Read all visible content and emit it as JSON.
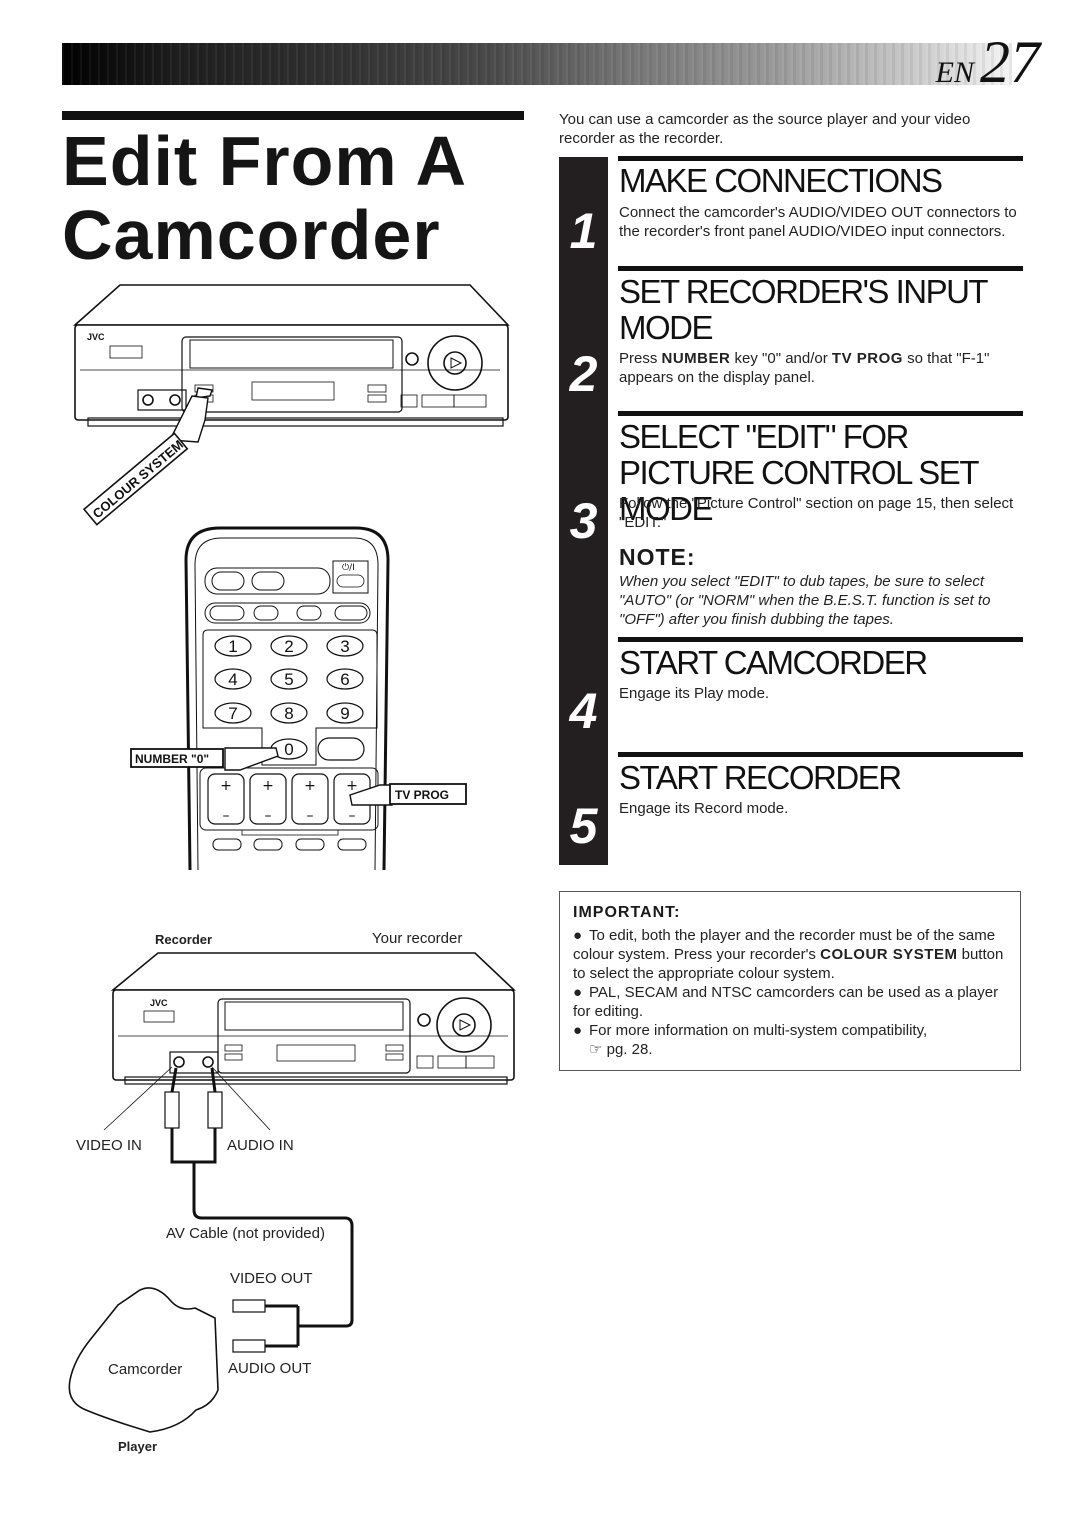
{
  "header": {
    "lang_code": "EN",
    "page_number": "27"
  },
  "title": {
    "line1": "Edit From A",
    "line2": "Camcorder"
  },
  "intro": "You can use a camcorder as the source player and your video recorder as the recorder.",
  "steps": [
    {
      "number": "1",
      "title": "MAKE CONNECTIONS",
      "text": "Connect the camcorder's AUDIO/VIDEO OUT connectors to the recorder's front panel AUDIO/VIDEO input connectors."
    },
    {
      "number": "2",
      "title": "SET RECORDER'S INPUT MODE",
      "text_pre": "Press ",
      "key1": "NUMBER",
      "text_mid": " key \"0\" and/or ",
      "key2": "TV PROG",
      "text_post": " so that \"F-1\" appears on the display panel."
    },
    {
      "number": "3",
      "title": "SELECT \"EDIT\" FOR PICTURE CONTROL SET MODE",
      "text": "Follow the \"Picture Control\" section on page 15, then select \"EDIT.\""
    },
    {
      "number": "4",
      "title": "START CAMCORDER",
      "text": "Engage its Play mode."
    },
    {
      "number": "5",
      "title": "START RECORDER",
      "text": "Engage its Record mode."
    }
  ],
  "note": {
    "heading": "NOTE:",
    "text": "When you select \"EDIT\" to dub tapes, be sure to select \"AUTO\" (or \"NORM\" when the B.E.S.T. function is set to \"OFF\") after you finish dubbing the tapes."
  },
  "important": {
    "heading": "IMPORTANT:",
    "bullet": "●",
    "item1_pre": "To edit, both the player and the recorder must be of the same colour system. Press your recorder's ",
    "item1_key": "COLOUR SYSTEM",
    "item1_post": " button to select the appropriate colour system.",
    "item2": "PAL, SECAM and NTSC camcorders can be used as a player for editing.",
    "item3": "For more information on multi-system compatibility,",
    "item3_ref_icon": "☞",
    "item3_ref": "pg. 28."
  },
  "illustration_top": {
    "brand": "JVC",
    "callout_colour_system": "COLOUR SYSTEM",
    "remote_keys": [
      "1",
      "2",
      "3",
      "4",
      "5",
      "6",
      "7",
      "8",
      "9",
      "0"
    ],
    "callout_number": "NUMBER \"0\"",
    "callout_tvprog": "TV PROG",
    "power_label": "⏻/I"
  },
  "illustration_bottom": {
    "recorder_label": "Recorder",
    "your_recorder_label": "Your recorder",
    "brand": "JVC",
    "video_in": "VIDEO IN",
    "audio_in": "AUDIO IN",
    "cable_label": "AV Cable (not provided)",
    "video_out": "VIDEO OUT",
    "audio_out": "AUDIO OUT",
    "camcorder_label": "Camcorder",
    "player_label": "Player"
  }
}
